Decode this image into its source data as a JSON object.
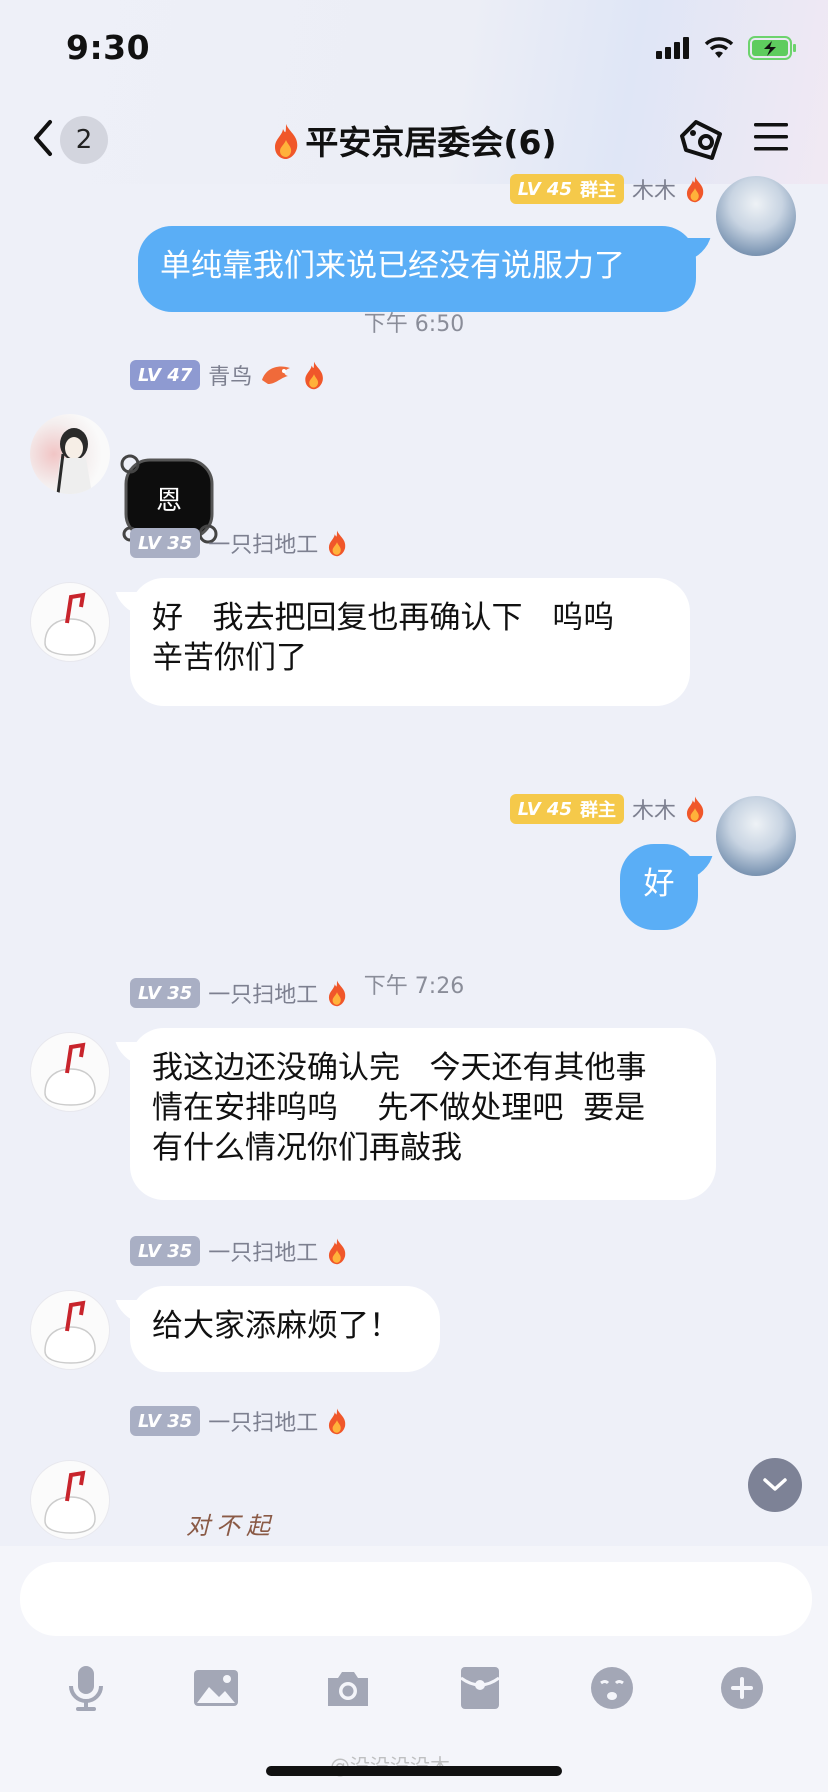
{
  "status_bar": {
    "time": "9:30"
  },
  "header": {
    "back_count": "2",
    "title": "平安京居委会(6)"
  },
  "messages": [
    {
      "level": "LV 45",
      "role": "群主",
      "name": "木木",
      "text": "单纯靠我们来说已经没有说服力了"
    },
    {
      "timestamp": "下午 6:50"
    },
    {
      "level": "LV 47",
      "name": "青鸟",
      "sticker_text": "恩"
    },
    {
      "level": "LV 35",
      "name": "一只扫地工",
      "line1": "好   我去把回复也再确认下   呜呜",
      "line2": "辛苦你们了"
    },
    {
      "level": "LV 45",
      "role": "群主",
      "name": "木木",
      "text": "好"
    },
    {
      "timestamp": "下午 7:26"
    },
    {
      "level": "LV 35",
      "name": "一只扫地工",
      "line1": "我这边还没确认完   今天还有其他事",
      "line2": "情在安排呜呜    先不做处理吧  要是",
      "line3": "有什么情况你们再敲我"
    },
    {
      "level": "LV 35",
      "name": "一只扫地工",
      "text": "给大家添麻烦了！"
    },
    {
      "level": "LV 35",
      "name": "一只扫地工",
      "sticker_text": "对不起"
    }
  ],
  "input": {
    "placeholder": ""
  },
  "toolbar": {
    "icons": [
      "microphone-icon",
      "image-icon",
      "camera-icon",
      "red-packet-icon",
      "emoji-icon",
      "plus-icon"
    ]
  },
  "watermark": "@没没没没木",
  "colors": {
    "bubble_blue": "#5aaef6",
    "level_gold": "#f5c94a",
    "level_grey": "#a9afc4",
    "level_purple": "#8e9ad1"
  }
}
